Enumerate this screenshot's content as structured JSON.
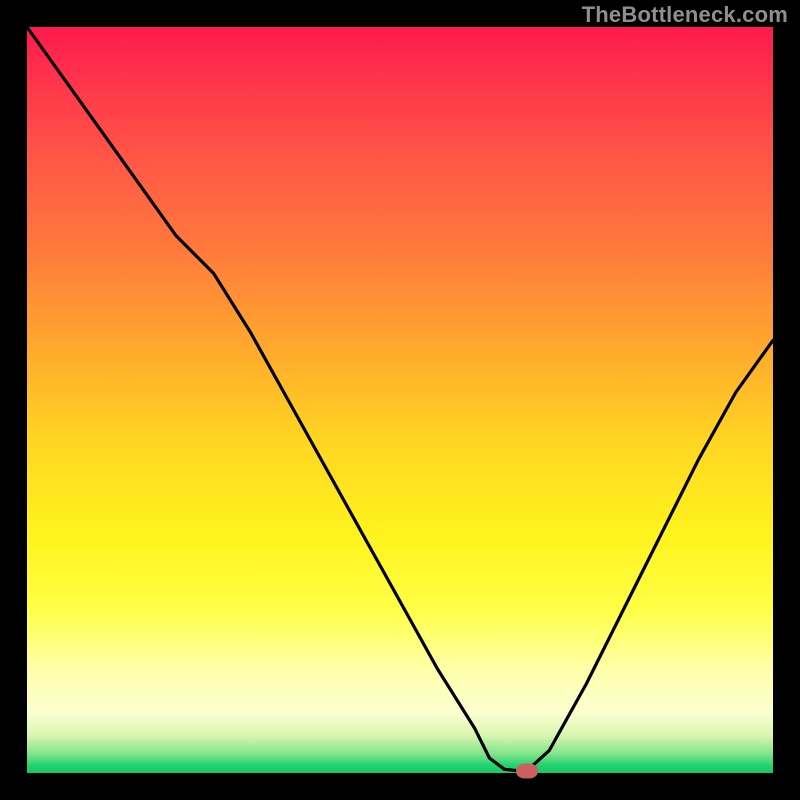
{
  "watermark": "TheBottleneck.com",
  "colors": {
    "curve": "#000000",
    "marker": "#cc605e",
    "background_top": "#ff1a4d",
    "background_bottom": "#17c765"
  },
  "chart_data": {
    "type": "line",
    "title": "",
    "xlabel": "",
    "ylabel": "",
    "xlim": [
      0,
      100
    ],
    "ylim": [
      0,
      100
    ],
    "x": [
      0,
      5,
      10,
      15,
      20,
      25,
      30,
      35,
      40,
      45,
      50,
      55,
      60,
      62,
      64,
      66,
      67,
      70,
      75,
      80,
      85,
      90,
      95,
      100
    ],
    "y": [
      100,
      93,
      86,
      79,
      72,
      67,
      59,
      50,
      41,
      32,
      23,
      14,
      6,
      2,
      0.5,
      0.3,
      0.3,
      3,
      12,
      22,
      32,
      42,
      51,
      58
    ],
    "marker": {
      "x": 67,
      "y": 0.3
    },
    "annotations": []
  }
}
